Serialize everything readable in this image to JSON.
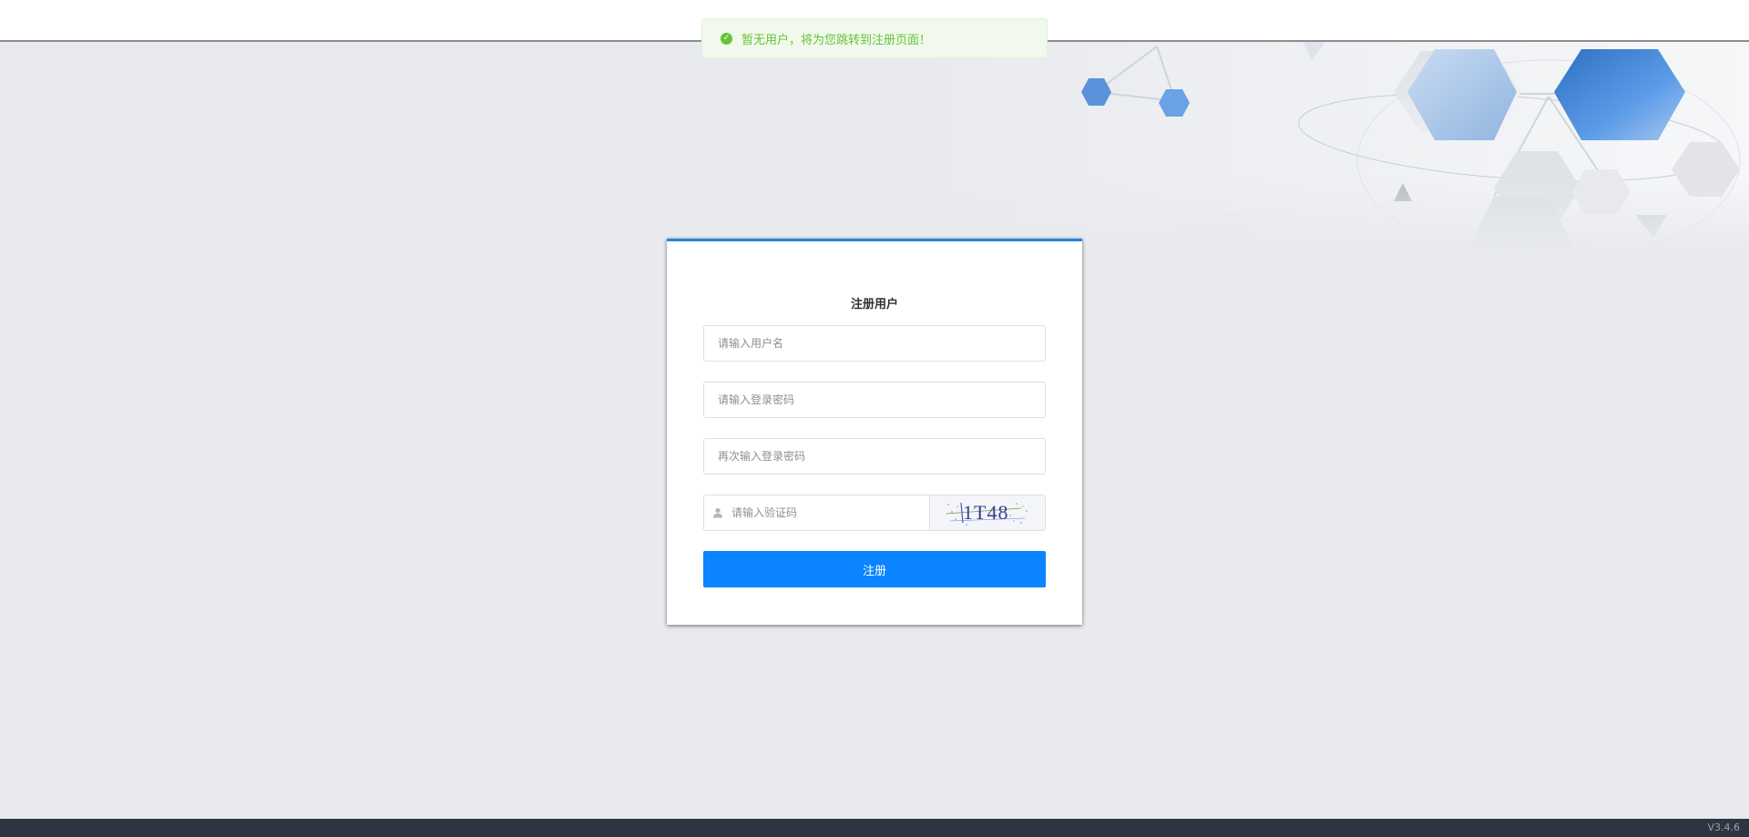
{
  "toast": {
    "message": "暂无用户，将为您跳转到注册页面！",
    "type": "success",
    "color": "#67c23a"
  },
  "form": {
    "title": "注册用户",
    "username_placeholder": "请输入用户名",
    "password_placeholder": "请输入登录密码",
    "confirm_password_placeholder": "再次输入登录密码",
    "captcha_placeholder": "请输入验证码",
    "captcha_code": "1T48",
    "submit_label": "注册"
  },
  "footer": {
    "version": "V3.4.6"
  },
  "colors": {
    "accent": "#0a84ff",
    "card_top_border": "#1e88e5",
    "background": "#e8eaee"
  }
}
